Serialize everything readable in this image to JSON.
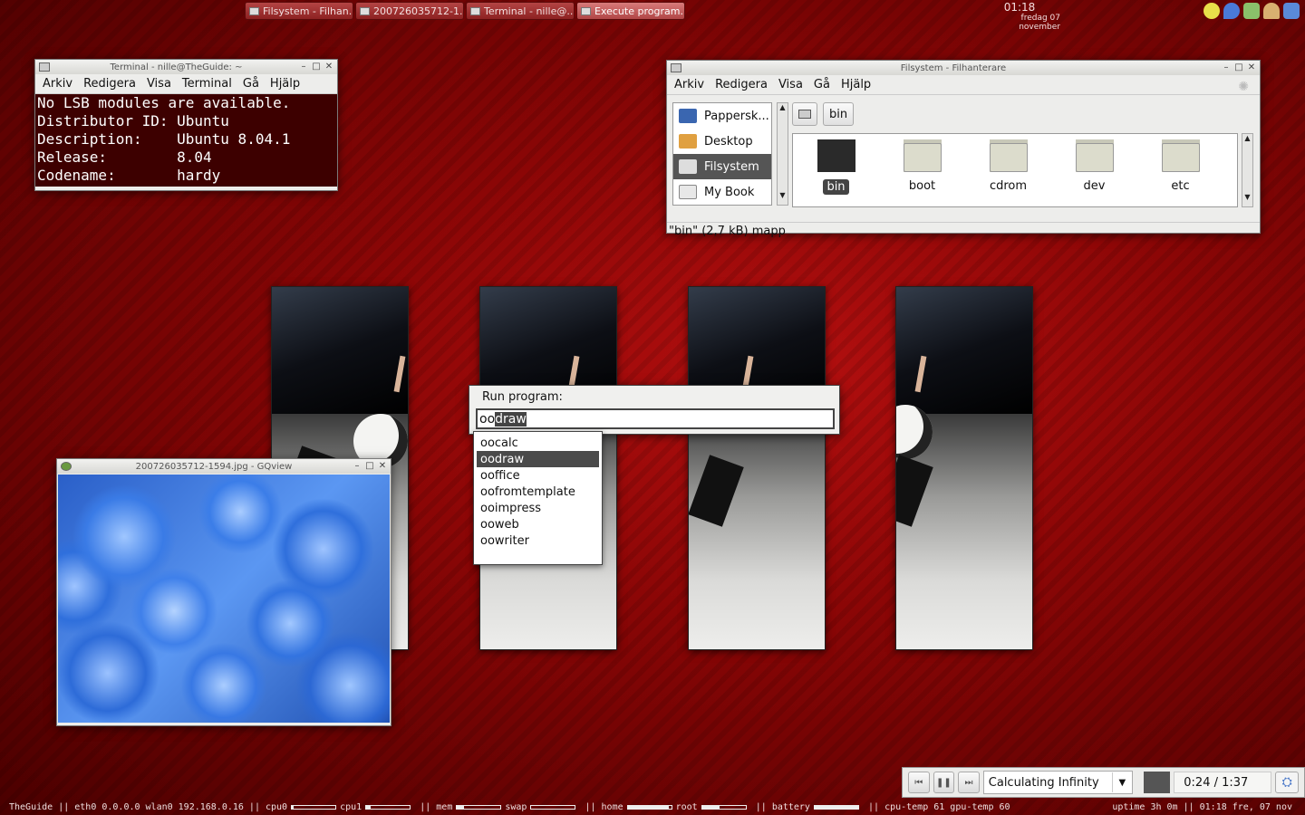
{
  "panel": {
    "tasks": [
      {
        "label": "Filsystem - Filhan...",
        "active": false
      },
      {
        "label": "200726035712-1...",
        "active": false
      },
      {
        "label": "Terminal - nille@...",
        "active": false
      },
      {
        "label": "Execute program...",
        "active": true
      }
    ],
    "clock_time": "01:18",
    "clock_date": "fredag 07 november"
  },
  "terminal": {
    "title": "Terminal - nille@TheGuide: ~",
    "menu": [
      "Arkiv",
      "Redigera",
      "Visa",
      "Terminal",
      "Gå",
      "Hjälp"
    ],
    "lines": [
      "No LSB modules are available.",
      "Distributor ID: Ubuntu",
      "Description:    Ubuntu 8.04.1",
      "Release:        8.04",
      "Codename:       hardy"
    ]
  },
  "filemanager": {
    "title": "Filsystem - Filhanterare",
    "menu": [
      "Arkiv",
      "Redigera",
      "Visa",
      "Gå",
      "Hjälp"
    ],
    "places": [
      {
        "label": "Pappersk...",
        "selected": false,
        "icon": "trash-icon"
      },
      {
        "label": "Desktop",
        "selected": false,
        "icon": "desktop-icon"
      },
      {
        "label": "Filsystem",
        "selected": true,
        "icon": "drive-icon"
      },
      {
        "label": "My Book",
        "selected": false,
        "icon": "external-drive-icon"
      }
    ],
    "path_button": "bin",
    "folders": [
      {
        "label": "bin",
        "selected": true
      },
      {
        "label": "boot",
        "selected": false
      },
      {
        "label": "cdrom",
        "selected": false
      },
      {
        "label": "dev",
        "selected": false
      },
      {
        "label": "etc",
        "selected": false
      }
    ],
    "status": "\"bin\" (2,7 kB) mapp"
  },
  "run_dialog": {
    "label": "Run program:",
    "typed": "oo",
    "completed": "draw",
    "suggestions": [
      {
        "label": "oocalc",
        "selected": false
      },
      {
        "label": "oodraw",
        "selected": true
      },
      {
        "label": "ooffice",
        "selected": false
      },
      {
        "label": "oofromtemplate",
        "selected": false
      },
      {
        "label": "ooimpress",
        "selected": false
      },
      {
        "label": "ooweb",
        "selected": false
      },
      {
        "label": "oowriter",
        "selected": false
      }
    ]
  },
  "gqview": {
    "title": "200726035712-1594.jpg - GQview"
  },
  "player": {
    "track": "Calculating Infinity",
    "time": "0:24 / 1:37"
  },
  "statusbar": {
    "host": "TheGuide",
    "net": "eth0 0.0.0.0 wlan0 192.168.0.16",
    "meters": [
      {
        "label": "cpu0",
        "level": 0.05
      },
      {
        "label": "cpu1",
        "level": 0.1
      },
      {
        "label": "mem",
        "level": 0.15
      },
      {
        "label": "swap",
        "level": 0.0
      },
      {
        "label": "home",
        "level": 0.95
      },
      {
        "label": "root",
        "level": 0.4
      },
      {
        "label": "battery",
        "level": 1.0
      }
    ],
    "temps": "cpu-temp 61 gpu-temp 60",
    "right": "uptime 3h 0m || 01:18 fre, 07 nov"
  },
  "colors": {
    "accent": "#444444",
    "desktop": "#8a0606",
    "terminal_bg": "#3d0000"
  }
}
